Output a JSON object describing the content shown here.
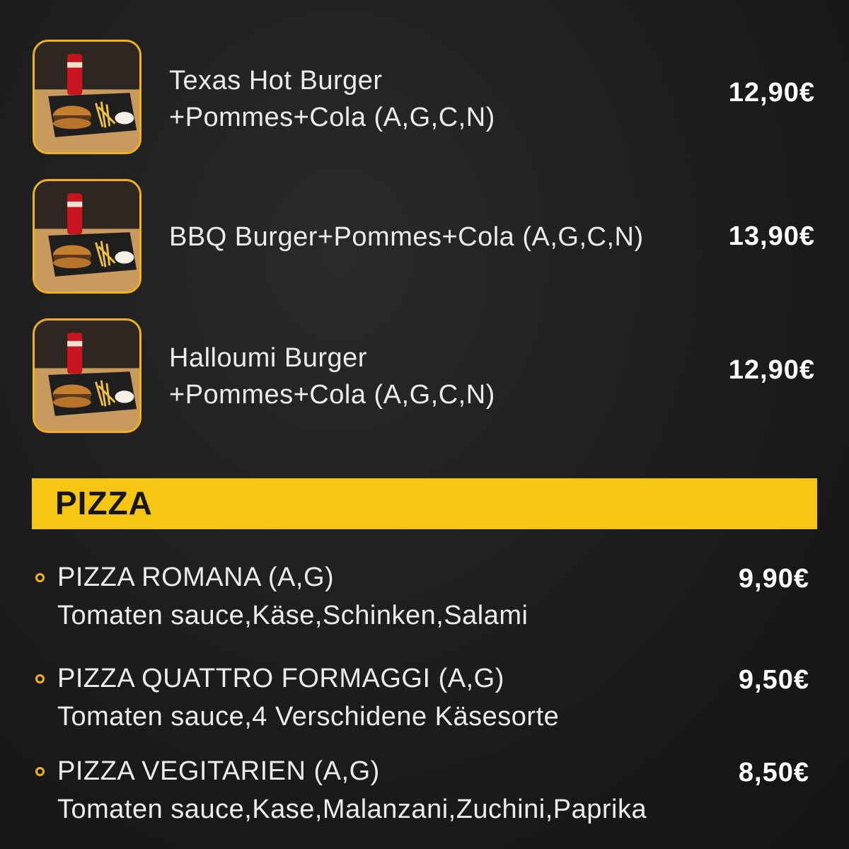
{
  "combos": [
    {
      "name_line1": "Texas Hot Burger",
      "name_line2": "+Pommes+Cola (A,G,C,N)",
      "price": "12,90€",
      "image": "burger-fries-cola-photo"
    },
    {
      "name_line1": "BBQ Burger+Pommes+Cola (A,G,C,N)",
      "name_line2": "",
      "price": "13,90€",
      "image": "burger-fries-cola-photo"
    },
    {
      "name_line1": "Halloumi Burger",
      "name_line2": "+Pommes+Cola (A,G,C,N)",
      "price": "12,90€",
      "image": "burger-fries-cola-photo"
    }
  ],
  "section": {
    "title": "PIZZA",
    "color": "#f7c613"
  },
  "pizzas": [
    {
      "name": "PIZZA ROMANA (A,G)",
      "description": "Tomaten sauce,Käse,Schinken,Salami",
      "price": "9,90€"
    },
    {
      "name": "PIZZA QUATTRO FORMAGGI  (A,G)",
      "description": "Tomaten sauce,4 Verschidene Käsesorte",
      "price": "9,50€"
    },
    {
      "name": "PIZZA VEGITARIEN  (A,G)",
      "description": "Tomaten sauce,Kase,Malanzani,Zuchini,Paprika",
      "price": "8,50€"
    }
  ],
  "colors": {
    "accent": "#f2b21c",
    "background": "#1c1c1c",
    "text": "#ececec"
  }
}
